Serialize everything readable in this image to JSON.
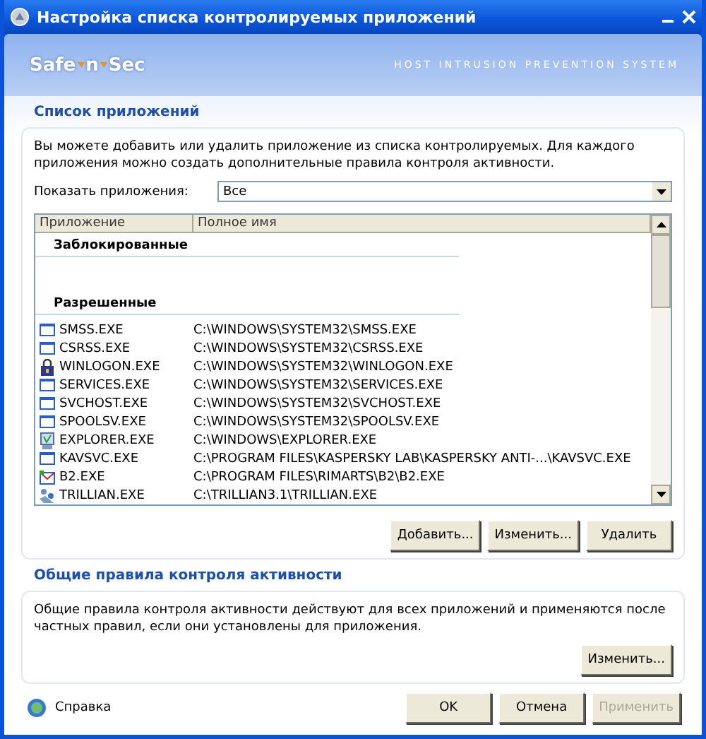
{
  "window": {
    "title": "Настройка списка контролируемых приложений"
  },
  "header": {
    "logo": [
      "Safe",
      "n",
      "Sec"
    ],
    "tagline": "HOST INTRUSION PREVENTION SYSTEM"
  },
  "applications": {
    "title": "Список приложений",
    "description": "Вы можете добавить или удалить приложение из списка контролируемых. Для каждого приложения можно создать дополнительные правила контроля активности.",
    "filter": {
      "label": "Показать приложения:",
      "value": "Все"
    },
    "table": {
      "columns": [
        "Приложение",
        "Полное имя"
      ],
      "groups": [
        {
          "title": "Заблокированные"
        },
        {
          "title": "Разрешенные",
          "rows": [
            {
              "name": "SMSS.EXE",
              "path": "C:\\WINDOWS\\SYSTEM32\\SMSS.EXE",
              "kind": "window"
            },
            {
              "name": "CSRSS.EXE",
              "path": "C:\\WINDOWS\\SYSTEM32\\CSRSS.EXE",
              "kind": "window"
            },
            {
              "name": "WINLOGON.EXE",
              "path": "C:\\WINDOWS\\SYSTEM32\\WINLOGON.EXE",
              "kind": "lock"
            },
            {
              "name": "SERVICES.EXE",
              "path": "C:\\WINDOWS\\SYSTEM32\\SERVICES.EXE",
              "kind": "window"
            },
            {
              "name": "SVCHOST.EXE",
              "path": "C:\\WINDOWS\\SYSTEM32\\SVCHOST.EXE",
              "kind": "window"
            },
            {
              "name": "SPOOLSV.EXE",
              "path": "C:\\WINDOWS\\SYSTEM32\\SPOOLSV.EXE",
              "kind": "window"
            },
            {
              "name": "EXPLORER.EXE",
              "path": "C:\\WINDOWS\\EXPLORER.EXE",
              "kind": "explorer"
            },
            {
              "name": "KAVSVC.EXE",
              "path": "C:\\PROGRAM FILES\\KASPERSKY LAB\\KASPERSKY ANTI-...\\KAVSVC.EXE",
              "kind": "window"
            },
            {
              "name": "B2.EXE",
              "path": "C:\\PROGRAM FILES\\RIMARTS\\B2\\B2.EXE",
              "kind": "mail"
            },
            {
              "name": "TRILLIAN.EXE",
              "path": "C:\\TRILLIAN3.1\\TRILLIAN.EXE",
              "kind": "people"
            }
          ]
        }
      ]
    },
    "buttons": [
      {
        "label": "Добавить...",
        "disabled": false
      },
      {
        "label": "Изменить...",
        "disabled": false
      },
      {
        "label": "Удалить",
        "disabled": false
      }
    ]
  },
  "rules": {
    "title": "Общие правила контроля активности",
    "description": "Общие правила контроля активности действуют для всех приложений и применяются после частных правил, если они установлены для приложения.",
    "buttons": [
      {
        "label": "Изменить...",
        "disabled": false
      }
    ]
  },
  "footer": {
    "help": "Справка",
    "buttons": [
      {
        "label": "OK",
        "disabled": false
      },
      {
        "label": "Отмена",
        "disabled": false
      },
      {
        "label": "Применить",
        "disabled": true
      }
    ]
  }
}
